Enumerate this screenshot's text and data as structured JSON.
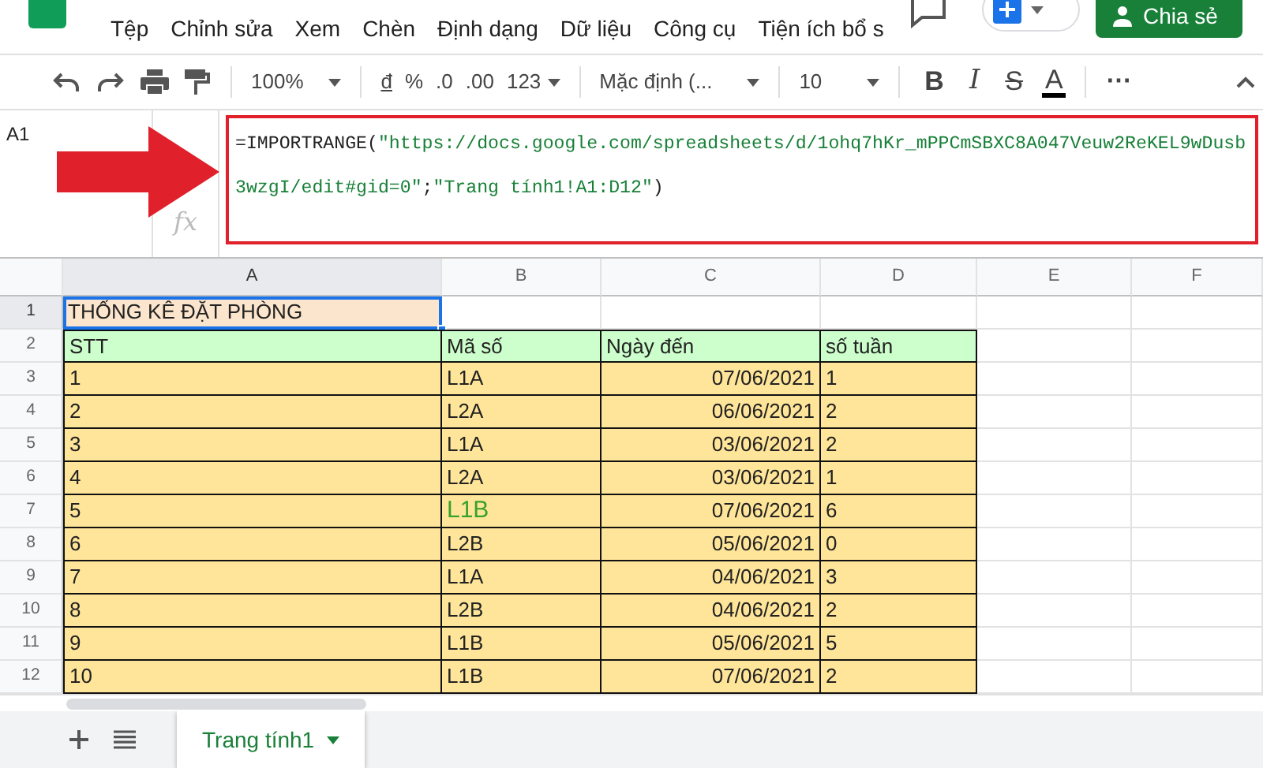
{
  "menu": [
    "Tệp",
    "Chỉnh sửa",
    "Xem",
    "Chèn",
    "Định dạng",
    "Dữ liệu",
    "Công cụ",
    "Tiện ích bổ s"
  ],
  "share_button": {
    "label": "Chia sẻ"
  },
  "toolbar": {
    "zoom": "100%",
    "currency": "đ",
    "percent": "%",
    "decimal_decrease": ".0",
    "decimal_increase": ".00",
    "number_format": "123",
    "font": "Mặc định (...",
    "font_size": "10",
    "bold": "B",
    "italic": "I",
    "strikethrough": "S",
    "text_color": "A",
    "more": "⋯"
  },
  "formula_bar": {
    "cell_ref": "A1",
    "fx": "fx",
    "formula": [
      {
        "kind": "plain",
        "text": "=IMPORTRANGE("
      },
      {
        "kind": "string",
        "text": "\"https://docs.google.com/spreadsheets/d/1ohq7hKr_mPPCmSBXC8A047Veuw2ReKEL9wDusb3wzgI/edit#gid=0\""
      },
      {
        "kind": "plain",
        "text": ";"
      },
      {
        "kind": "string",
        "text": "\"Trang tính1!A1:D12\""
      },
      {
        "kind": "plain",
        "text": ")"
      }
    ]
  },
  "columns": [
    {
      "label": "A",
      "selected": true
    },
    {
      "label": "B",
      "selected": false
    },
    {
      "label": "C",
      "selected": false
    },
    {
      "label": "D",
      "selected": false
    },
    {
      "label": "E",
      "selected": false
    },
    {
      "label": "F",
      "selected": false
    }
  ],
  "rows": [
    {
      "number": "1",
      "kind": "title",
      "selected": true,
      "cells": [
        {
          "text": "THỐNG KÊ ĐẶT PHÒNG"
        }
      ]
    },
    {
      "number": "2",
      "kind": "header",
      "selected": false,
      "cells": [
        {
          "text": "STT"
        },
        {
          "text": "Mã số"
        },
        {
          "text": "Ngày đến"
        },
        {
          "text": "số tuần"
        }
      ]
    },
    {
      "number": "3",
      "kind": "data",
      "selected": false,
      "cells": [
        {
          "text": "1"
        },
        {
          "text": "L1A"
        },
        {
          "text": "07/06/2021"
        },
        {
          "text": "1"
        }
      ]
    },
    {
      "number": "4",
      "kind": "data",
      "selected": false,
      "cells": [
        {
          "text": "2"
        },
        {
          "text": "L2A"
        },
        {
          "text": "06/06/2021"
        },
        {
          "text": "2"
        }
      ]
    },
    {
      "number": "5",
      "kind": "data",
      "selected": false,
      "cells": [
        {
          "text": "3"
        },
        {
          "text": "L1A"
        },
        {
          "text": "03/06/2021"
        },
        {
          "text": "2"
        }
      ]
    },
    {
      "number": "6",
      "kind": "data",
      "selected": false,
      "cells": [
        {
          "text": "4"
        },
        {
          "text": "L2A"
        },
        {
          "text": "03/06/2021"
        },
        {
          "text": "1"
        }
      ]
    },
    {
      "number": "7",
      "kind": "data",
      "selected": false,
      "cells": [
        {
          "text": "5"
        },
        {
          "text": "L1B",
          "color": "#38a12a"
        },
        {
          "text": "07/06/2021"
        },
        {
          "text": "6"
        }
      ]
    },
    {
      "number": "8",
      "kind": "data",
      "selected": false,
      "cells": [
        {
          "text": "6"
        },
        {
          "text": "L2B"
        },
        {
          "text": "05/06/2021"
        },
        {
          "text": "0"
        }
      ]
    },
    {
      "number": "9",
      "kind": "data",
      "selected": false,
      "cells": [
        {
          "text": "7"
        },
        {
          "text": "L1A"
        },
        {
          "text": "04/06/2021"
        },
        {
          "text": "3"
        }
      ]
    },
    {
      "number": "10",
      "kind": "data",
      "selected": false,
      "cells": [
        {
          "text": "8"
        },
        {
          "text": "L2B"
        },
        {
          "text": "04/06/2021"
        },
        {
          "text": "2"
        }
      ]
    },
    {
      "number": "11",
      "kind": "data",
      "selected": false,
      "cells": [
        {
          "text": "9"
        },
        {
          "text": "L1B"
        },
        {
          "text": "05/06/2021"
        },
        {
          "text": "5"
        }
      ]
    },
    {
      "number": "12",
      "kind": "data",
      "selected": false,
      "cells": [
        {
          "text": "10"
        },
        {
          "text": "L1B"
        },
        {
          "text": "07/06/2021"
        },
        {
          "text": "2"
        }
      ]
    }
  ],
  "sheet_tabs": [
    {
      "label": "Trang tính1",
      "selected": true
    }
  ]
}
